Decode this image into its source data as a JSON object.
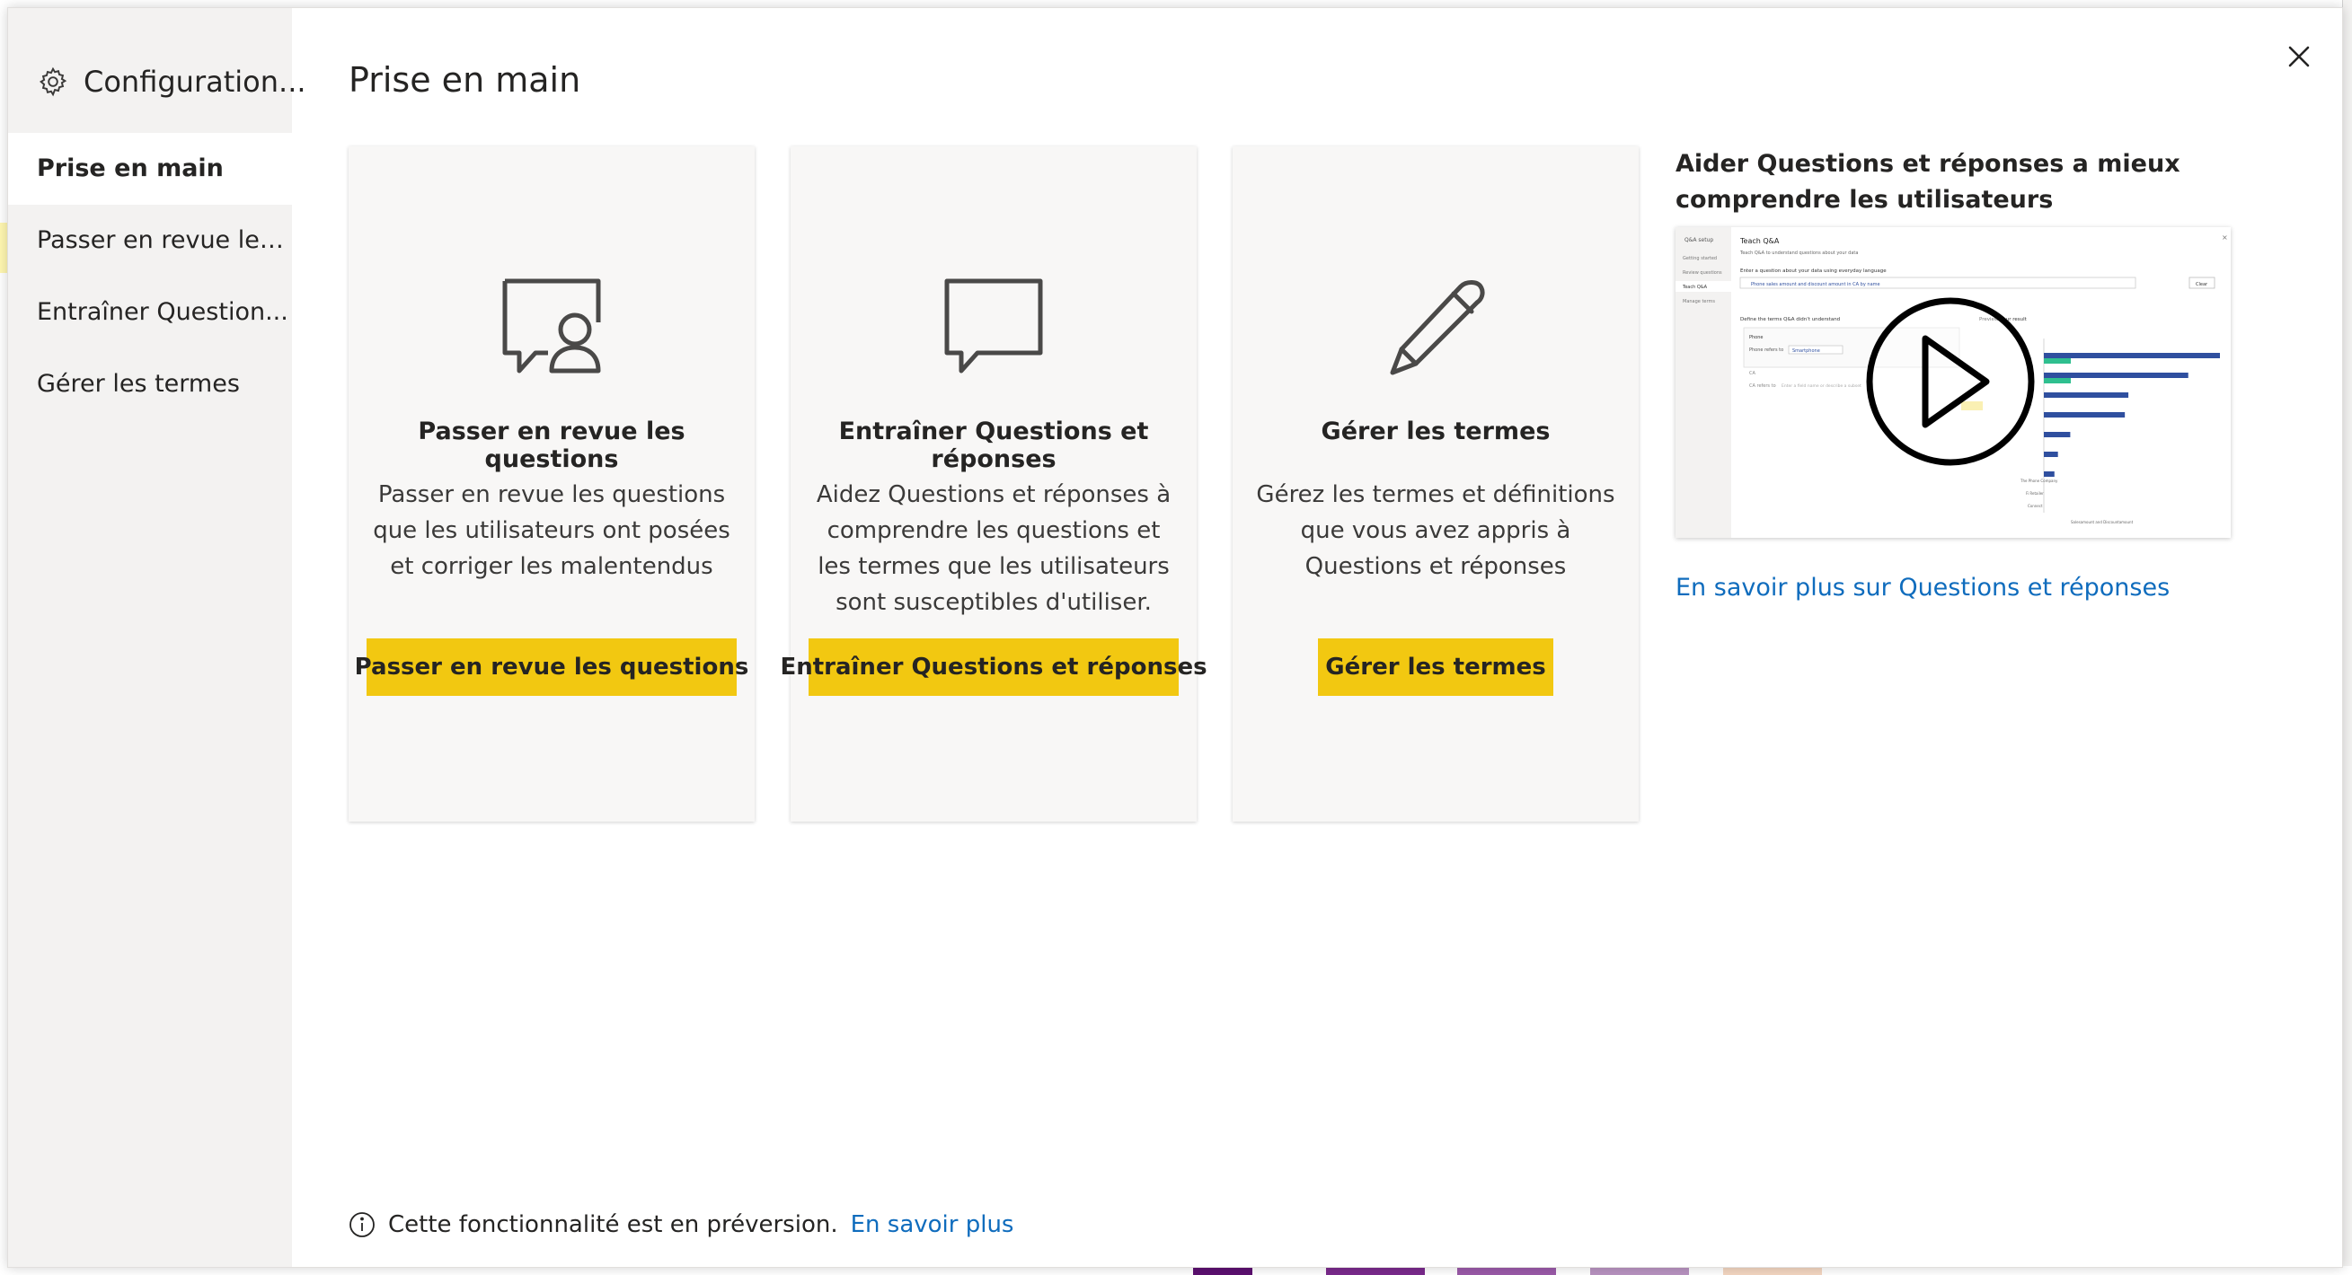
{
  "sidebar": {
    "header": "Configuration...",
    "items": [
      {
        "label": "Prise en main",
        "active": true
      },
      {
        "label": "Passer en revue les..."
      },
      {
        "label": "Entraîner Question..."
      },
      {
        "label": "Gérer les termes"
      }
    ]
  },
  "main": {
    "title": "Prise en main",
    "cards": [
      {
        "icon": "chat-person-icon",
        "title": "Passer en revue les questions",
        "description": "Passer en revue les questions que les utilisateurs ont posées et corriger les malentendus",
        "button": "Passer en revue les questions"
      },
      {
        "icon": "chat-bubble-icon",
        "title": "Entraîner Questions et réponses",
        "description": "Aidez Questions et réponses à comprendre les questions et les termes que les utilisateurs sont susceptibles d'utiliser.",
        "button": "Entraîner Questions et réponses"
      },
      {
        "icon": "pencil-icon",
        "title": "Gérer les termes",
        "description": "Gérez les termes et définitions que vous avez appris à Questions et réponses",
        "button": "Gérer les termes"
      }
    ],
    "video": {
      "title": "Aider Questions et réponses a mieux comprendre les utilisateurs",
      "link": "En savoir plus sur Questions et réponses",
      "thumbnail_labels": {
        "sidebar_title": "Q&A setup",
        "sidebar_items": [
          "Getting started",
          "Review questions",
          "Teach Q&A",
          "Manage terms"
        ],
        "heading": "Teach Q&A",
        "subheading": "Teach Q&A to understand questions about your data",
        "section1": "Enter a question about your data using everyday language",
        "query": "Phone sales amount and discount amount in CA by name",
        "clear": "Clear",
        "section2": "Define the terms Q&A didn't understand",
        "preview": "Preview your result",
        "term_label": "Phone",
        "refers_label": "Phone refers to",
        "refers_value": "Smartphone",
        "ca_label": "CA",
        "ca_refers": "CA refers to",
        "ca_placeholder": "Enter a field name or describe a subset",
        "bar_values": [
          100,
          82,
          48,
          46,
          15,
          8,
          6
        ],
        "bar_labels": [
          "",
          "",
          "",
          "",
          "The Phone Company",
          "Fi Retailer",
          "Connect"
        ],
        "footer": "Salesamount and Discountamount"
      }
    }
  },
  "footer": {
    "text": "Cette fonctionnalité est en préversion.",
    "link": "En savoir plus"
  },
  "colors": {
    "accent_button": "#f2c811",
    "link": "#0f6cbd",
    "sidebar_bg": "#f3f2f1",
    "card_bg": "#f8f7f6",
    "bar_primary": "#2f4f9f",
    "bar_secondary": "#2fbf8f"
  }
}
